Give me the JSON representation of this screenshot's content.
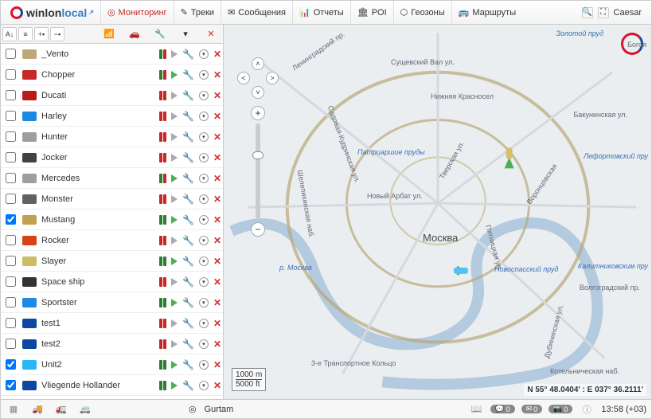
{
  "brand": {
    "name1": "winlon",
    "name2": "local"
  },
  "tabs": [
    {
      "label": "Мониторинг",
      "active": true
    },
    {
      "label": "Треки"
    },
    {
      "label": "Сообщения"
    },
    {
      "label": "Отчеты"
    },
    {
      "label": "POI"
    },
    {
      "label": "Геозоны"
    },
    {
      "label": "Маршруты"
    }
  ],
  "user": "Caesar",
  "units": [
    {
      "name": "_Vento",
      "checked": false,
      "color": "#bfa77a",
      "sig": [
        "#2e7d32",
        "#c62828"
      ],
      "play": false
    },
    {
      "name": "Chopper",
      "checked": false,
      "color": "#c62828",
      "sig": [
        "#2e7d32",
        "#c62828"
      ],
      "play": true
    },
    {
      "name": "Ducati",
      "checked": false,
      "color": "#b71c1c",
      "sig": [
        "#c62828",
        "#c62828"
      ],
      "play": false
    },
    {
      "name": "Harley",
      "checked": false,
      "color": "#1e88e5",
      "sig": [
        "#c62828",
        "#c62828"
      ],
      "play": false
    },
    {
      "name": "Hunter",
      "checked": false,
      "color": "#9e9e9e",
      "sig": [
        "#c62828",
        "#c62828"
      ],
      "play": false
    },
    {
      "name": "Jocker",
      "checked": false,
      "color": "#424242",
      "sig": [
        "#c62828",
        "#c62828"
      ],
      "play": false
    },
    {
      "name": "Mercedes",
      "checked": false,
      "color": "#9e9e9e",
      "sig": [
        "#2e7d32",
        "#c62828"
      ],
      "play": true
    },
    {
      "name": "Monster",
      "checked": false,
      "color": "#616161",
      "sig": [
        "#c62828",
        "#c62828"
      ],
      "play": false
    },
    {
      "name": "Mustang",
      "checked": true,
      "color": "#c2a050",
      "sig": [
        "#2e7d32",
        "#2e7d32"
      ],
      "play": true
    },
    {
      "name": "Rocker",
      "checked": false,
      "color": "#d84315",
      "sig": [
        "#c62828",
        "#c62828"
      ],
      "play": false
    },
    {
      "name": "Slayer",
      "checked": false,
      "color": "#cabd62",
      "sig": [
        "#2e7d32",
        "#2e7d32"
      ],
      "play": true
    },
    {
      "name": "Space ship",
      "checked": false,
      "color": "#333",
      "sig": [
        "#c62828",
        "#c62828"
      ],
      "play": false
    },
    {
      "name": "Sportster",
      "checked": false,
      "color": "#1e88e5",
      "sig": [
        "#2e7d32",
        "#2e7d32"
      ],
      "play": true
    },
    {
      "name": "test1",
      "checked": false,
      "color": "#0d47a1",
      "sig": [
        "#c62828",
        "#c62828"
      ],
      "play": false
    },
    {
      "name": "test2",
      "checked": false,
      "color": "#0d47a1",
      "sig": [
        "#c62828",
        "#c62828"
      ],
      "play": false
    },
    {
      "name": "Unit2",
      "checked": true,
      "color": "#29b6f6",
      "sig": [
        "#2e7d32",
        "#2e7d32"
      ],
      "play": true
    },
    {
      "name": "Vliegende Hollander",
      "checked": true,
      "color": "#0d47a1",
      "sig": [
        "#2e7d32",
        "#2e7d32"
      ],
      "play": true
    }
  ],
  "map": {
    "city": "Москва",
    "labels": {
      "l1": "Золотой пруд",
      "l2": "Богоя",
      "l3": "Сущевский Вал ул.",
      "l4": "Ленинградский пр.",
      "l5": "Нижняя Красносел",
      "l6": "Бакунинская ул.",
      "l7": "Садовая-Кудринская ул.",
      "l8": "Патриаршие пруды",
      "l9": "Лефортовский пру",
      "l10": "Новый Арбат ул.",
      "l11": "Тверская ул.",
      "l12": "Воронцовская",
      "l13": "Пятницкая ул.",
      "l14": "Новоспасский пруд",
      "l15": "Калитниковским пру",
      "l16": "Волгоградский пр.",
      "l17": "3-е Транспортное Кольцо",
      "l18": "Котельническая наб.",
      "l19": "Дубининская ул.",
      "l20": "р. Москва",
      "l21": "Шелепихинская наб."
    },
    "scale": {
      "m": "1000 m",
      "ft": "5000 ft"
    },
    "coords": "N 55° 48.0404' : E 037° 36.2111'"
  },
  "bottom": {
    "company": "Gurtam",
    "badges": [
      "0",
      "0",
      "0"
    ],
    "time": "13:58 (+03)"
  }
}
